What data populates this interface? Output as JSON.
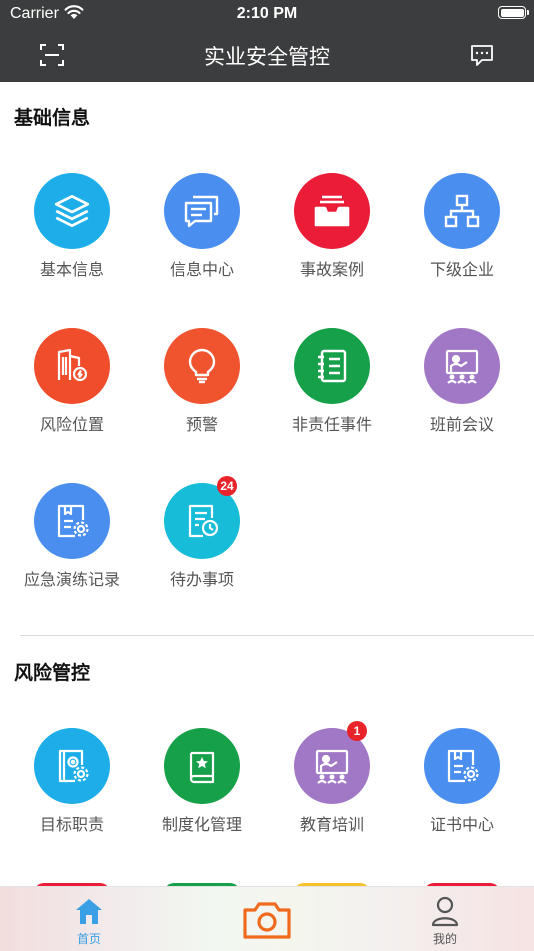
{
  "status": {
    "carrier": "Carrier",
    "time": "2:10 PM"
  },
  "header": {
    "title": "实业安全管控"
  },
  "sections": [
    {
      "title": "基础信息",
      "items": [
        {
          "label": "基本信息",
          "icon": "layers-icon",
          "color": "#1daee9"
        },
        {
          "label": "信息中心",
          "icon": "chat-bubbles-icon",
          "color": "#4a8eef"
        },
        {
          "label": "事故案例",
          "icon": "inbox-tray-icon",
          "color": "#ea1c38"
        },
        {
          "label": "下级企业",
          "icon": "org-chart-icon",
          "color": "#4a8eef"
        },
        {
          "label": "风险位置",
          "icon": "building-icon",
          "color": "#f04d2c"
        },
        {
          "label": "预警",
          "icon": "lightbulb-icon",
          "color": "#f0542f"
        },
        {
          "label": "非责任事件",
          "icon": "notebook-list-icon",
          "color": "#17a04a"
        },
        {
          "label": "班前会议",
          "icon": "meeting-board-icon",
          "color": "#a178c6"
        },
        {
          "label": "应急演练记录",
          "icon": "document-gear-icon",
          "color": "#4a8eef"
        },
        {
          "label": "待办事项",
          "icon": "document-clock-icon",
          "color": "#16bcd8",
          "badge": "24"
        }
      ]
    },
    {
      "title": "风险管控",
      "items": [
        {
          "label": "目标职责",
          "icon": "target-book-icon",
          "color": "#1daee9"
        },
        {
          "label": "制度化管理",
          "icon": "star-book-icon",
          "color": "#17a04a"
        },
        {
          "label": "教育培训",
          "icon": "training-board-icon",
          "color": "#a178c6",
          "badge": "1"
        },
        {
          "label": "证书中心",
          "icon": "certificate-gear-icon",
          "color": "#4a8eef"
        }
      ]
    }
  ],
  "peek_colors": [
    "#ea1c38",
    "#17a04a",
    "#f5c22a",
    "#ea1c38"
  ],
  "tabbar": {
    "home": {
      "label": "首页",
      "color": "#3aa0e6"
    },
    "camera": {
      "color": "#f06a1e"
    },
    "mine": {
      "label": "我的",
      "color": "#555555"
    }
  }
}
